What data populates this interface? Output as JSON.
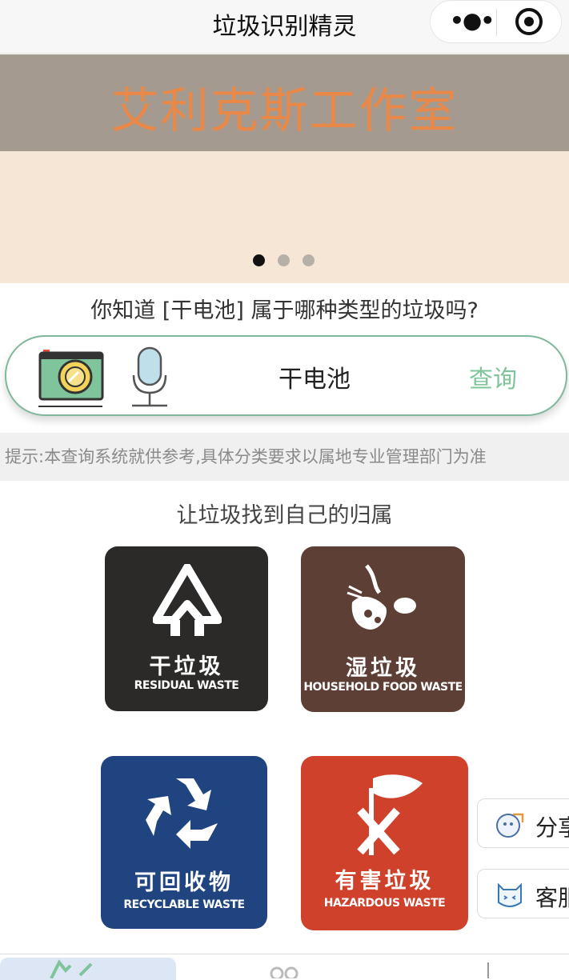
{
  "navbar": {
    "title": "垃圾识别精灵",
    "more_icon": "more-dots-icon",
    "close_icon": "target-close-icon"
  },
  "banner": {
    "text": "艾利克斯工作室",
    "slides": 3,
    "active_slide": 1
  },
  "question": "你知道 [干电池] 属于哪种类型的垃圾吗?",
  "search": {
    "value": "干电池",
    "button": "查询",
    "camera_icon": "camera-icon",
    "mic_icon": "microphone-icon"
  },
  "tip": "提示:本查询系统就供参考,具体分类要求以属地专业管理部门为准",
  "section_title": "让垃圾找到自己的归属",
  "categories": [
    {
      "cn": "干垃圾",
      "en": "RESIDUAL WASTE",
      "color": "#2b2a28",
      "icon": "residual-waste-icon"
    },
    {
      "cn": "湿垃圾",
      "en": "HOUSEHOLD FOOD WASTE",
      "color": "#5e3f35",
      "icon": "food-waste-icon"
    },
    {
      "cn": "可回收物",
      "en": "RECYCLABLE WASTE",
      "color": "#1f4480",
      "icon": "recycle-icon"
    },
    {
      "cn": "有害垃圾",
      "en": "HAZARDOUS WASTE",
      "color": "#d0412c",
      "icon": "hazardous-icon"
    }
  ],
  "floating": {
    "share": "分享",
    "service": "客服"
  },
  "colors": {
    "accent": "#7fc49b",
    "border": "#7fb89a"
  }
}
